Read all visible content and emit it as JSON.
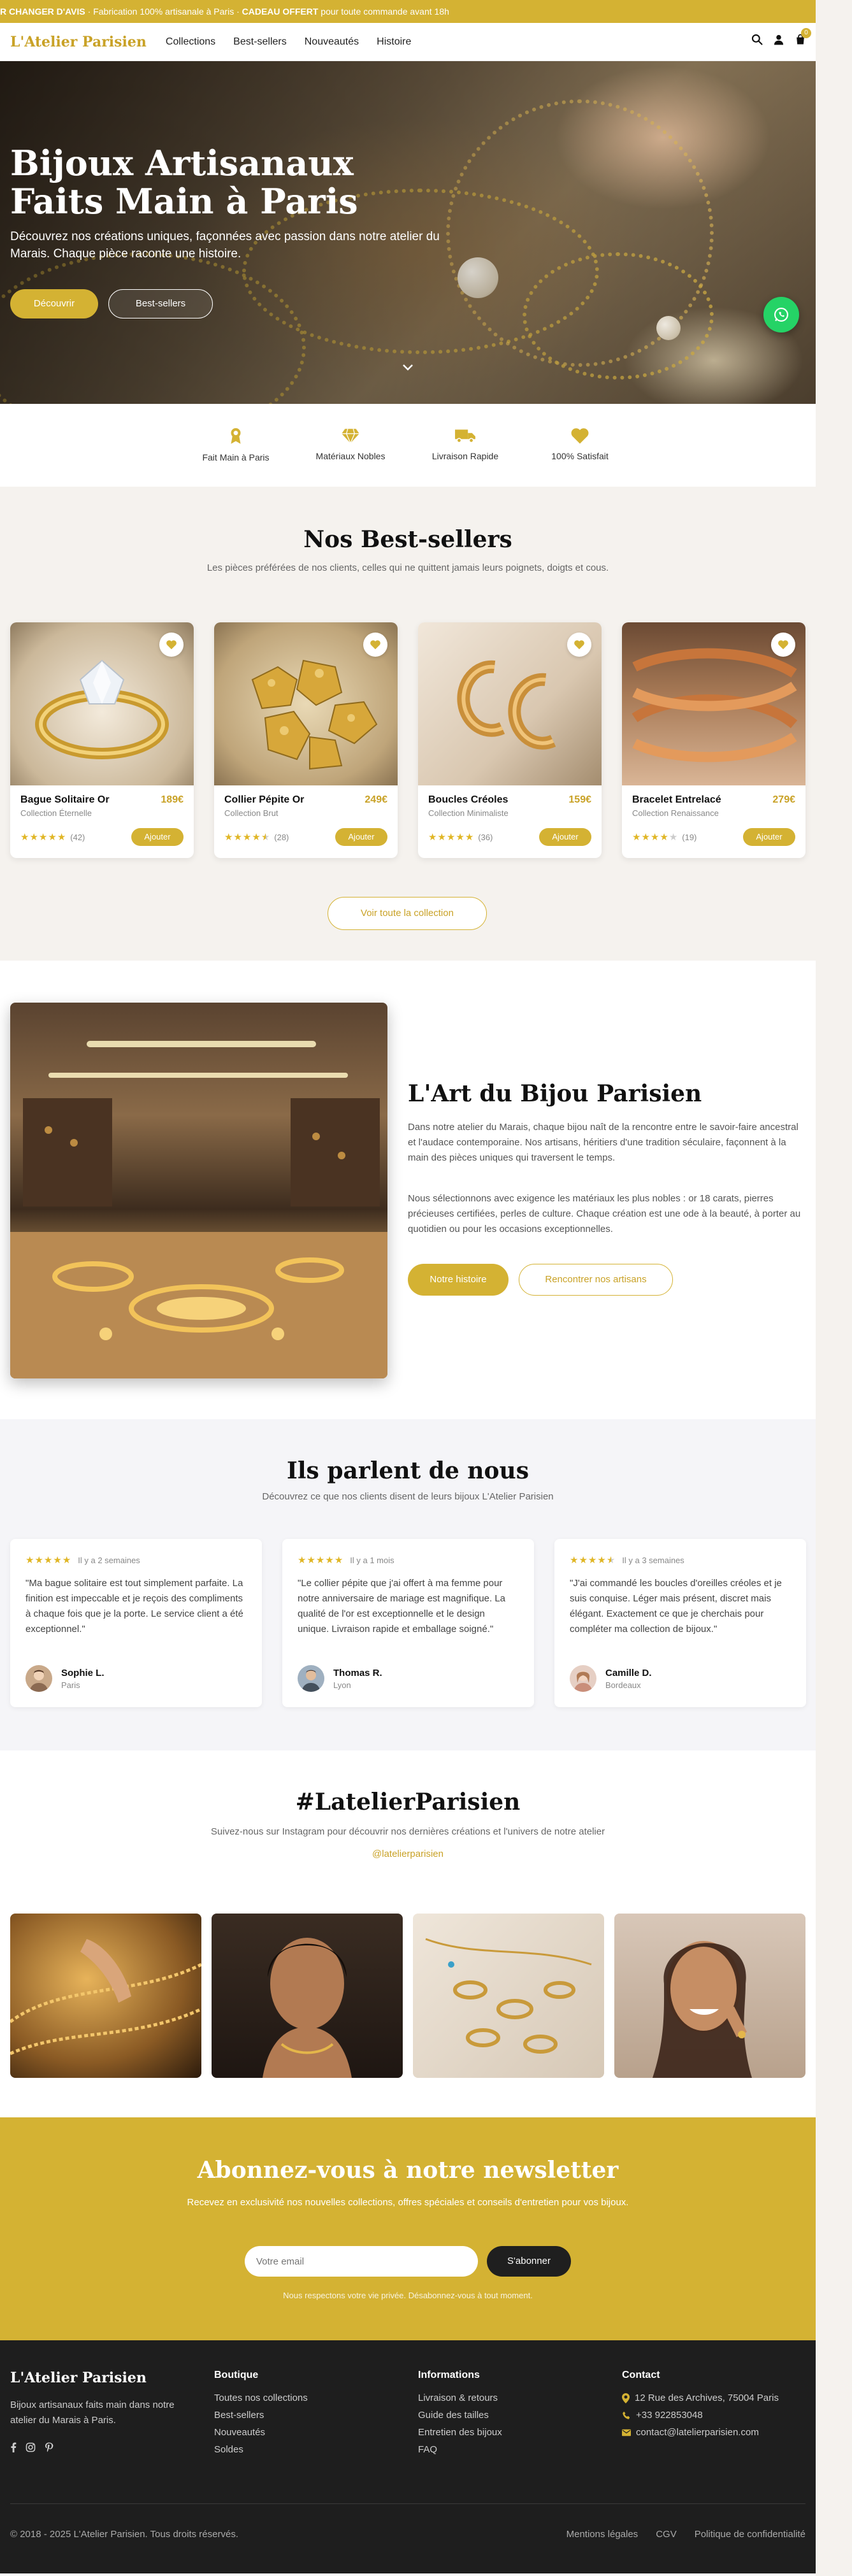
{
  "announcement": {
    "part1": "R CHANGER D'AVIS",
    "part2": " · Fabrication 100% artisanale à Paris · ",
    "part3": "CADEAU OFFERT",
    "part4": " pour toute commande avant 18h"
  },
  "header": {
    "logo": "L'Atelier Parisien",
    "nav": [
      "Collections",
      "Best-sellers",
      "Nouveautés",
      "Histoire"
    ],
    "cart_count": "0"
  },
  "hero": {
    "title": "Bijoux Artisanaux Faits Main à Paris",
    "subtitle": "Découvrez nos créations uniques, façonnées avec passion dans notre atelier du Marais. Chaque pièce raconte une histoire.",
    "primary_button": "Découvrir",
    "secondary_button": "Best-sellers"
  },
  "features": [
    {
      "icon": "award-icon",
      "label": "Fait Main à Paris"
    },
    {
      "icon": "gem-icon",
      "label": "Matériaux Nobles"
    },
    {
      "icon": "truck-icon",
      "label": "Livraison Rapide"
    },
    {
      "icon": "heart-icon",
      "label": "100% Satisfait"
    }
  ],
  "bestsellers": {
    "title": "Nos Best-sellers",
    "subtitle": "Les pièces préférées de nos clients, celles qui ne quittent jamais leurs poignets, doigts et cous.",
    "add_label": "Ajouter",
    "view_all": "Voir toute la collection",
    "products": [
      {
        "name": "Bague Solitaire Or",
        "price": "189€",
        "collection": "Collection Éternelle",
        "rating": 5,
        "count": "(42)"
      },
      {
        "name": "Collier Pépite Or",
        "price": "249€",
        "collection": "Collection Brut",
        "rating": 4.5,
        "count": "(28)"
      },
      {
        "name": "Boucles Créoles",
        "price": "159€",
        "collection": "Collection Minimaliste",
        "rating": 5,
        "count": "(36)"
      },
      {
        "name": "Bracelet Entrelacé",
        "price": "279€",
        "collection": "Collection Renaissance",
        "rating": 4,
        "count": "(19)"
      }
    ]
  },
  "about": {
    "title": "L'Art du Bijou Parisien",
    "p1": "Dans notre atelier du Marais, chaque bijou naît de la rencontre entre le savoir-faire ancestral et l'audace contemporaine. Nos artisans, héritiers d'une tradition séculaire, façonnent à la main des pièces uniques qui traversent le temps.",
    "p2": "Nous sélectionnons avec exigence les matériaux les plus nobles : or 18 carats, pierres précieuses certifiées, perles de culture. Chaque création est une ode à la beauté, à porter au quotidien ou pour les occasions exceptionnelles.",
    "button1": "Notre histoire",
    "button2": "Rencontrer nos artisans"
  },
  "testimonials": {
    "title": "Ils parlent de nous",
    "subtitle": "Découvrez ce que nos clients disent de leurs bijoux L'Atelier Parisien",
    "items": [
      {
        "rating": 5,
        "time": "Il y a 2 semaines",
        "quote": "\"Ma bague solitaire est tout simplement parfaite. La finition est impeccable et je reçois des compliments à chaque fois que je la porte. Le service client a été exceptionnel.\"",
        "name": "Sophie L.",
        "city": "Paris"
      },
      {
        "rating": 5,
        "time": "Il y a 1 mois",
        "quote": "\"Le collier pépite que j'ai offert à ma femme pour notre anniversaire de mariage est magnifique. La qualité de l'or est exceptionnelle et le design unique. Livraison rapide et emballage soigné.\"",
        "name": "Thomas R.",
        "city": "Lyon"
      },
      {
        "rating": 4.5,
        "time": "Il y a 3 semaines",
        "quote": "\"J'ai commandé les boucles d'oreilles créoles et je suis conquise. Léger mais présent, discret mais élégant. Exactement ce que je cherchais pour compléter ma collection de bijoux.\"",
        "name": "Camille D.",
        "city": "Bordeaux"
      }
    ]
  },
  "instagram": {
    "title": "#LatelierParisien",
    "subtitle": "Suivez-nous sur Instagram pour découvrir nos dernières créations et l'univers de notre atelier",
    "handle": "@latelierparisien"
  },
  "newsletter": {
    "title": "Abonnez-vous à notre newsletter",
    "subtitle": "Recevez en exclusivité nos nouvelles collections, offres spéciales et conseils d'entretien pour vos bijoux.",
    "placeholder": "Votre email",
    "button": "S'abonner",
    "note": "Nous respectons votre vie privée. Désabonnez-vous à tout moment."
  },
  "footer": {
    "logo": "L'Atelier Parisien",
    "description": "Bijoux artisanaux faits main dans notre atelier du Marais à Paris.",
    "boutique_title": "Boutique",
    "boutique_links": [
      "Toutes nos collections",
      "Best-sellers",
      "Nouveautés",
      "Soldes"
    ],
    "info_title": "Informations",
    "info_links": [
      "Livraison & retours",
      "Guide des tailles",
      "Entretien des bijoux",
      "FAQ"
    ],
    "contact_title": "Contact",
    "address": "12 Rue des Archives, 75004 Paris",
    "phone": "+33 922853048",
    "email": "contact@latelierparisien.com",
    "copyright": "© 2018 - 2025 L'Atelier Parisien. Tous droits réservés.",
    "legal": [
      "Mentions légales",
      "CGV",
      "Politique de confidentialité"
    ]
  },
  "colors": {
    "accent": "#d4b233",
    "dark": "#1e1e1e",
    "whatsapp": "#25d366"
  }
}
